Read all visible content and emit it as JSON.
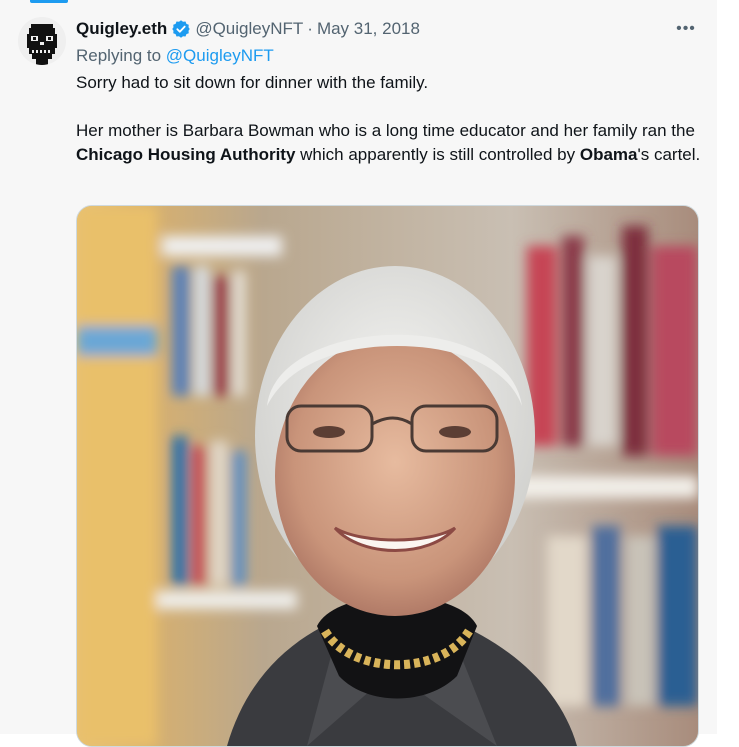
{
  "author": {
    "name": "Quigley.eth",
    "handle": "@QuigleyNFT",
    "separator": "·",
    "date": "May 31, 2018",
    "avatar_icon": "pixel-skull-avatar-icon",
    "verified_icon": "verified-badge-icon"
  },
  "reply": {
    "prefix": "Replying to",
    "to": "@QuigleyNFT"
  },
  "tweet": {
    "p1": "Sorry had to sit down for dinner with the family.",
    "p2_a": "Her mother is Barbara Bowman who is a long time educator and her family ran the ",
    "p2_bold1": "Chicago Housing Authority",
    "p2_b": " which apparently is still controlled by ",
    "p2_bold2": "Obama",
    "p2_c": "'s cartel."
  },
  "menu": {
    "more_label": "•••"
  },
  "media": {
    "description_icon": "photo-elderly-woman-library"
  },
  "colors": {
    "accent": "#1d9bf0",
    "text": "#0f1419",
    "muted": "#536471",
    "background": "#f7f7f7"
  }
}
